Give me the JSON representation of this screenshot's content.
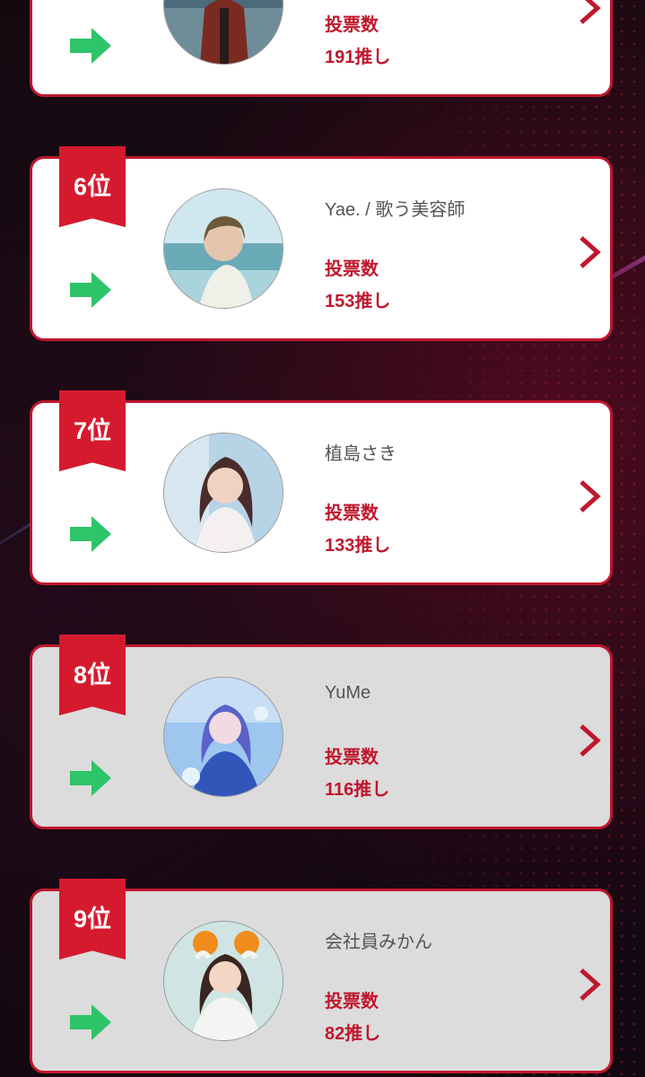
{
  "colors": {
    "accent_red": "#c0172d",
    "ribbon_red": "#d51a2e",
    "arrow_green": "#2ec46a",
    "card_white": "#ffffff",
    "card_gray": "#dcdcdc"
  },
  "entries": [
    {
      "rank_label": "",
      "name": "",
      "vote_label": "投票数",
      "vote_count": "191推し",
      "trend_icon": "arrow-right-icon",
      "avatar_colors": [
        "#4c6b7a",
        "#7b2a22",
        "#2a1a1a"
      ]
    },
    {
      "rank_label": "6位",
      "name": "Yae. / 歌う美容師",
      "vote_label": "投票数",
      "vote_count": "153推し",
      "trend_icon": "arrow-right-icon",
      "avatar_colors": [
        "#a9d4dc",
        "#6aa9b6",
        "#f0efe8"
      ]
    },
    {
      "rank_label": "7位",
      "name": "植島さき",
      "vote_label": "投票数",
      "vote_count": "133推し",
      "trend_icon": "arrow-right-icon",
      "avatar_colors": [
        "#b7d3e6",
        "#4a2d2a",
        "#f4f0f2"
      ]
    },
    {
      "rank_label": "8位",
      "name": "YuMe",
      "vote_label": "投票数",
      "vote_count": "116推し",
      "trend_icon": "arrow-right-icon",
      "avatar_colors": [
        "#9ec6ef",
        "#2f56b8",
        "#e8f2fb"
      ]
    },
    {
      "rank_label": "9位",
      "name": "会社員みかん",
      "vote_label": "投票数",
      "vote_count": "82推し",
      "trend_icon": "arrow-right-icon",
      "avatar_colors": [
        "#cfe4e3",
        "#f08c1c",
        "#3a2620"
      ]
    }
  ]
}
